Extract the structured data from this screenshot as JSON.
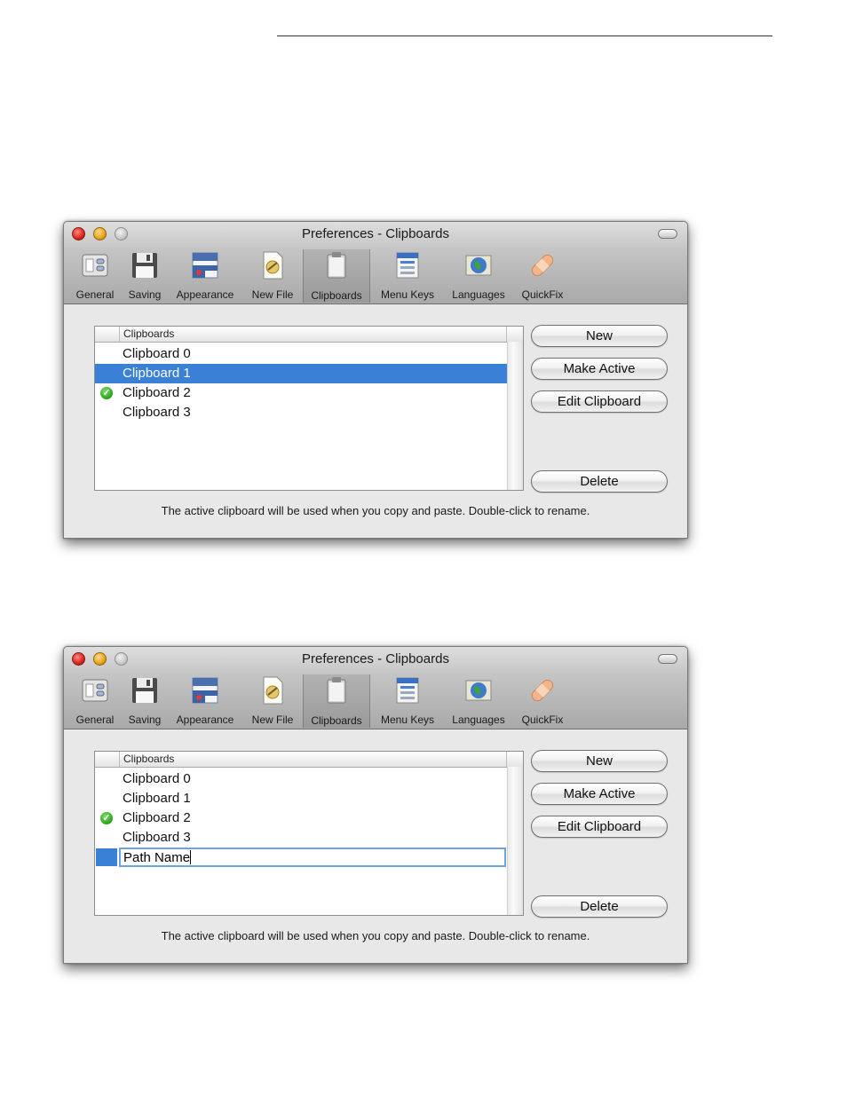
{
  "windows": [
    {
      "title": "Preferences - Clipboards",
      "toolbar": [
        "General",
        "Saving",
        "Appearance",
        "New File",
        "Clipboards",
        "Menu Keys",
        "Languages",
        "QuickFix"
      ],
      "selected_tab": "Clipboards",
      "list_header": "Clipboards",
      "rows": [
        {
          "name": "Clipboard 0",
          "active": false,
          "selected": false
        },
        {
          "name": "Clipboard 1",
          "active": false,
          "selected": true
        },
        {
          "name": "Clipboard 2",
          "active": true,
          "selected": false
        },
        {
          "name": "Clipboard 3",
          "active": false,
          "selected": false
        }
      ],
      "buttons": {
        "new": "New",
        "make_active": "Make Active",
        "edit": "Edit Clipboard",
        "delete": "Delete"
      },
      "note": "The active clipboard will be used when you copy and paste.  Double-click to rename."
    },
    {
      "title": "Preferences - Clipboards",
      "toolbar": [
        "General",
        "Saving",
        "Appearance",
        "New File",
        "Clipboards",
        "Menu Keys",
        "Languages",
        "QuickFix"
      ],
      "selected_tab": "Clipboards",
      "list_header": "Clipboards",
      "rows": [
        {
          "name": "Clipboard 0",
          "active": false,
          "selected": false
        },
        {
          "name": "Clipboard 1",
          "active": false,
          "selected": false
        },
        {
          "name": "Clipboard 2",
          "active": true,
          "selected": false
        },
        {
          "name": "Clipboard 3",
          "active": false,
          "selected": false
        }
      ],
      "editing_value": "Path Name",
      "buttons": {
        "new": "New",
        "make_active": "Make Active",
        "edit": "Edit Clipboard",
        "delete": "Delete"
      },
      "note": "The active clipboard will be used when you copy and paste.  Double-click to rename."
    }
  ],
  "colors": {
    "selection": "#3a80d6",
    "check": "#2aa019"
  },
  "icons": [
    "general-icon",
    "saving-floppy-icon",
    "appearance-icon",
    "new-file-icon",
    "clipboard-icon",
    "menu-keys-icon",
    "languages-globe-icon",
    "quickfix-bandage-icon"
  ]
}
